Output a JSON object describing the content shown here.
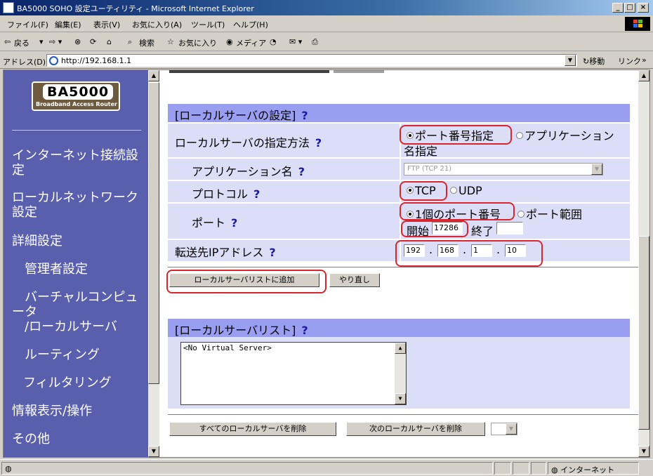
{
  "window": {
    "title": "BA5000 SOHO 設定ユーティリティ - Microsoft Internet Explorer",
    "min": "_",
    "max": "□",
    "close": "×"
  },
  "menu": [
    "ファイル(F)",
    "編集(E)",
    "表示(V)",
    "お気に入り(A)",
    "ツール(T)",
    "ヘルプ(H)"
  ],
  "toolbar": {
    "back": "戻る",
    "search": "検索",
    "favorites": "お気に入り",
    "media": "メディア"
  },
  "address": {
    "label": "アドレス(D)",
    "url": "http://192.168.1.1",
    "go": "移動",
    "links": "リンク"
  },
  "sidebar": {
    "logo_main": "BA5000",
    "logo_sub": "Broadband Access Router",
    "items": [
      "インターネット接続設定",
      "ローカルネットワーク設定",
      "詳細設定",
      "管理者設定",
      "バーチャルコンピュータ",
      "/ローカルサーバ",
      "ルーティング",
      "フィルタリング",
      "情報表示/操作",
      "その他"
    ]
  },
  "section1": {
    "title": "[ローカルサーバの設定]",
    "help": "?"
  },
  "method": {
    "label": "ローカルサーバの指定方法",
    "help": "?",
    "opt1": "ポート番号指定",
    "opt2": "アプリケーション",
    "opt2b": "名指定"
  },
  "appname": {
    "label": "アプリケーション名",
    "help": "?",
    "value": "FTP (TCP 21)"
  },
  "protocol": {
    "label": "プロトコル",
    "help": "?",
    "opt1": "TCP",
    "opt2": "UDP"
  },
  "port": {
    "label": "ポート",
    "help": "?",
    "opt1": "1個のポート番号",
    "opt2": "ポート範囲",
    "start_label": "開始",
    "start_value": "17286",
    "end_label": "終了",
    "end_value": ""
  },
  "dest": {
    "label": "転送先IPアドレス",
    "help": "?",
    "ip1": "192",
    "ip2": "168",
    "ip3": "1",
    "ip4": "10",
    "dot": "."
  },
  "buttons": {
    "add": "ローカルサーバリストに追加",
    "reset": "やり直し",
    "delete_all": "すべてのローカルサーバを削除",
    "delete_next": "次のローカルサーバを削除"
  },
  "section2": {
    "title": "[ローカルサーバリスト]",
    "help": "?"
  },
  "list": {
    "content": "<No Virtual Server>"
  },
  "status": {
    "zone": "インターネット"
  },
  "colors": {
    "sidebar": "#5a5fad",
    "section": "#9a9ef0",
    "row": "#dcdef8",
    "highlight": "#d7262e"
  }
}
